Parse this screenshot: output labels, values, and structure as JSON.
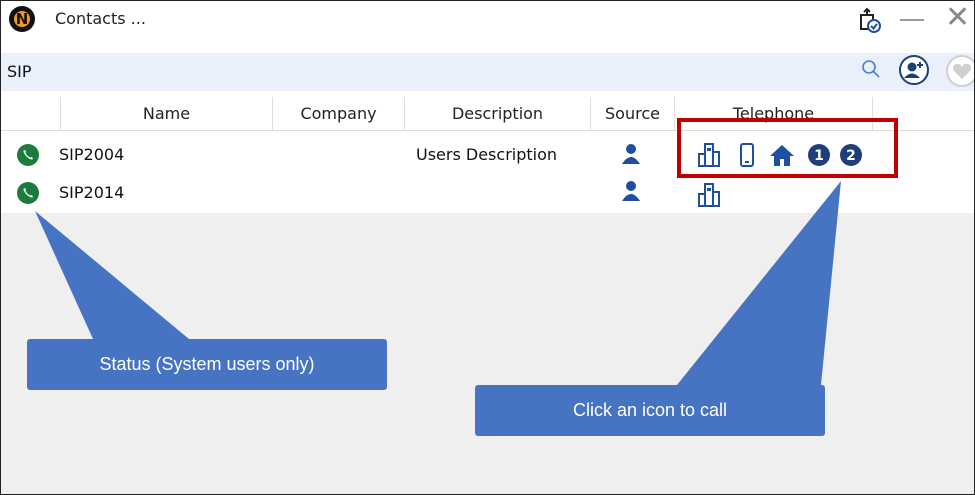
{
  "window": {
    "title": "Contacts ...",
    "logo_letter": "N"
  },
  "search": {
    "value": "SIP"
  },
  "table": {
    "columns": [
      "Name",
      "Company",
      "Description",
      "Source",
      "Telephone"
    ],
    "rows": [
      {
        "name": "SIP2004",
        "company": "",
        "description": "Users Description",
        "source": "user",
        "phones": [
          "office-icon",
          "mobile-icon",
          "home-icon",
          "1",
          "2"
        ]
      },
      {
        "name": "SIP2014",
        "company": "",
        "description": "",
        "source": "user",
        "phones": [
          "office-icon"
        ]
      }
    ]
  },
  "callouts": {
    "status": "Status (System users only)",
    "call": "Click an icon to call"
  },
  "colors": {
    "status_online": "#1a7c3a",
    "icon_blue": "#1f4fa0",
    "callout": "#4674c3",
    "highlight": "#c00000"
  }
}
